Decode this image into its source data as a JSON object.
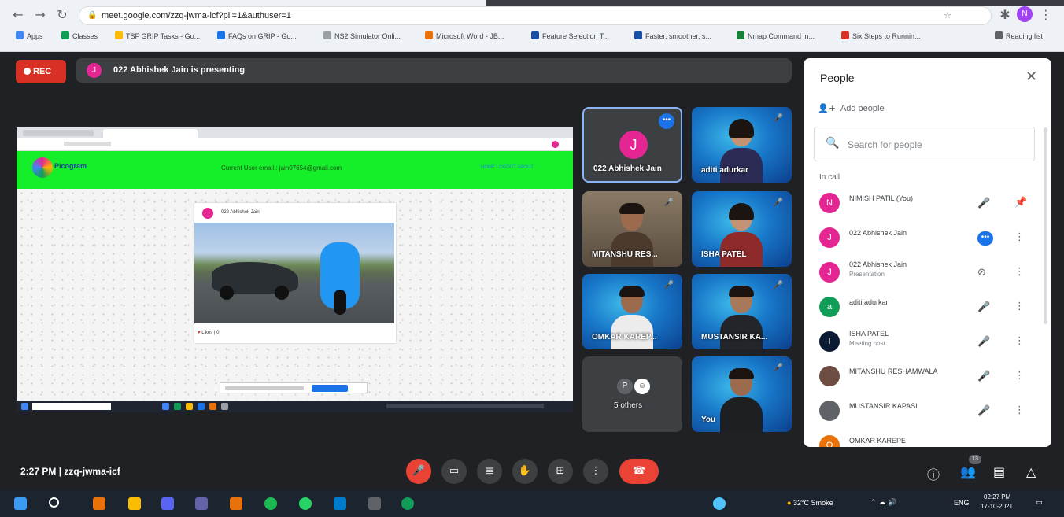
{
  "browser": {
    "url": "meet.google.com/zzq-jwma-icf?pli=1&authuser=1",
    "bookmarks": [
      "Apps",
      "Classes",
      "TSF GRIP Tasks - Go...",
      "FAQs on GRIP - Go...",
      "NS2 Simulator Onli...",
      "Microsoft Word - JB...",
      "Feature Selection T...",
      "Faster, smoother, s...",
      "Nmap Command in...",
      "Six Steps to Runnin...",
      "Reading list"
    ]
  },
  "meeting": {
    "rec_label": "REC",
    "presenter_initial": "J",
    "presenting_text": "022 Abhishek Jain is presenting",
    "time": "2:27 PM",
    "separator": "|",
    "meeting_code": "zzq-jwma-icf",
    "participant_count": "13"
  },
  "shared_screen": {
    "current_user_email": "Current User email : jain07654@gmail.com",
    "post_author": "022 Abhishek Jain",
    "likes": "Likes",
    "likes_count": "0",
    "nav_links": "HOME   LOGOUT   ABOUT",
    "logo_text": "Picogram"
  },
  "tiles": [
    {
      "name": "022 Abhishek Jain",
      "initial": "J"
    },
    {
      "name": "aditi adurkar"
    },
    {
      "name": "MITANSHU RES..."
    },
    {
      "name": "ISHA PATEL"
    },
    {
      "name": "OMKAR KAREP..."
    },
    {
      "name": "MUSTANSIR KA..."
    },
    {
      "name": "5 others",
      "initial": "P"
    },
    {
      "name": "You"
    }
  ],
  "people_panel": {
    "title": "People",
    "add_people": "Add people",
    "search_placeholder": "Search for people",
    "section": "In call",
    "people": [
      {
        "name": "NIMISH PATIL (You)",
        "initial": "N",
        "color": "#e52592",
        "sub": ""
      },
      {
        "name": "022 Abhishek Jain",
        "initial": "J",
        "color": "#e52592",
        "sub": ""
      },
      {
        "name": "022 Abhishek Jain",
        "initial": "J",
        "color": "#e52592",
        "sub": "Presentation"
      },
      {
        "name": "aditi adurkar",
        "initial": "a",
        "color": "#0f9d58",
        "sub": ""
      },
      {
        "name": "ISHA PATEL",
        "initial": "I",
        "color": "#0b1a33",
        "sub": "Meeting host"
      },
      {
        "name": "MITANSHU RESHAMWALA",
        "initial": "",
        "color": "#6d4c41",
        "sub": ""
      },
      {
        "name": "MUSTANSIR KAPASI",
        "initial": "",
        "color": "#5f6368",
        "sub": ""
      },
      {
        "name": "OMKAR KAREPE",
        "initial": "O",
        "color": "#e8710a",
        "sub": ""
      }
    ]
  },
  "taskbar": {
    "weather": "32°C Smoke",
    "lang": "ENG",
    "time": "02:27 PM",
    "date": "17-10-2021"
  },
  "colors": {
    "accent": "#1a73e8",
    "danger": "#ea4335",
    "bg": "#202124",
    "green": "#15ef29"
  }
}
